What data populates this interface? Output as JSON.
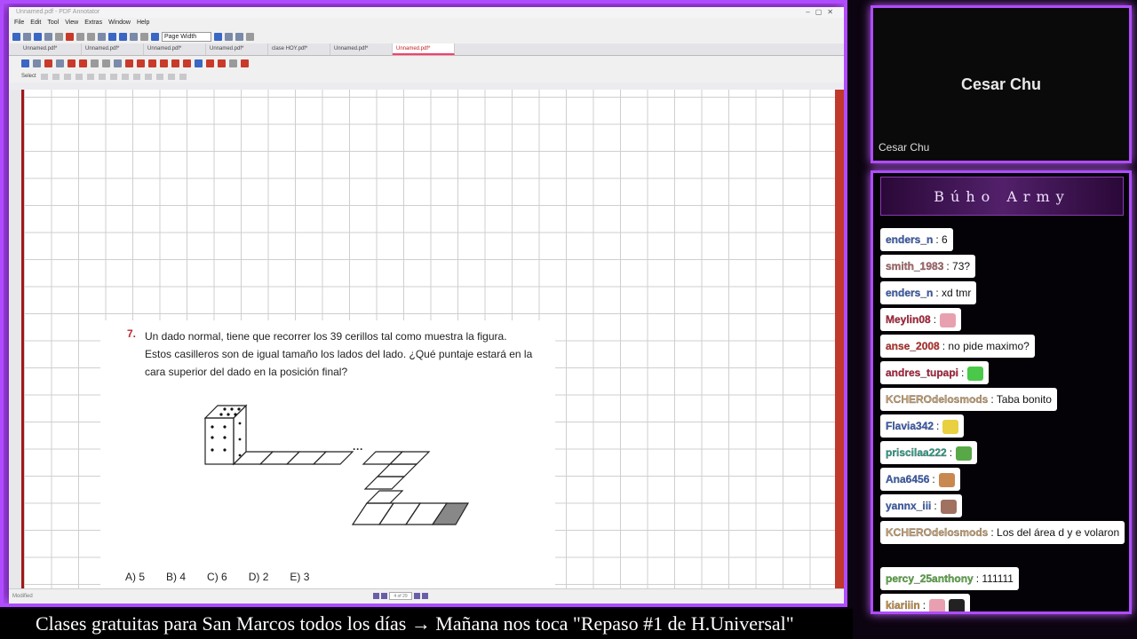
{
  "app": {
    "title": "Unnamed.pdf - PDF Annotator",
    "menu": [
      "File",
      "Edit",
      "Tool",
      "View",
      "Extras",
      "Window",
      "Help"
    ],
    "zoom_value": "Page Width",
    "tabs": [
      "Unnamed.pdf*",
      "Unnamed.pdf*",
      "Unnamed.pdf*",
      "Unnamed.pdf*",
      "clase HOY.pdf*",
      "Unnamed.pdf*",
      "Unnamed.pdf*"
    ],
    "active_tab": 6,
    "toolbar3_label": "Select",
    "status_left": "Modified",
    "page_indicator": "4 of 29"
  },
  "problem": {
    "number": "7.",
    "text": "Un dado normal, tiene que recorrer los 39 cerillos tal como muestra la figura. Estos casilleros son de igual tamaño los lados del lado. ¿Qué puntaje estará en la cara superior del dado en la posición final?",
    "dots": "···",
    "answers": [
      "A) 5",
      "B) 4",
      "C) 6",
      "D) 2",
      "E) 3"
    ]
  },
  "camera": {
    "name": "Cesar Chu",
    "label": "Cesar Chu"
  },
  "chat": {
    "title": "Búho Army",
    "messages": [
      {
        "user": "enders_n",
        "color": "#3a5fb8",
        "text": ": 6"
      },
      {
        "user": "smith_1983",
        "color": "#b06a6a",
        "text": ": 73?"
      },
      {
        "user": "enders_n",
        "color": "#3a5fb8",
        "text": ": xd tmr"
      },
      {
        "user": "Meylin08",
        "color": "#b8203a",
        "text": ":",
        "emote": "#e8a0b0"
      },
      {
        "user": "anse_2008",
        "color": "#c8302a",
        "text": ": no pide maximo?"
      },
      {
        "user": "andres_tupapi",
        "color": "#b8203a",
        "text": ":",
        "emote": "#4ac84a"
      },
      {
        "user": "KCHEROdelosmods",
        "color": "#c8a070",
        "text": ": Taba bonito"
      },
      {
        "user": "Flavia342",
        "color": "#3a5fb8",
        "text": ":",
        "emote": "#e8d040"
      },
      {
        "user": "priscilaa222",
        "color": "#2aa088",
        "text": ":",
        "emote": "#58a848"
      },
      {
        "user": "Ana6456",
        "color": "#3a5fb8",
        "text": ":",
        "emote": "#c88850"
      },
      {
        "user": "yannx_iii",
        "color": "#3a5fb8",
        "text": ":",
        "emote": "#a07060"
      },
      {
        "user": "KCHEROdelosmods",
        "color": "#c8a070",
        "text": ": Los del área d y e volaron"
      },
      {
        "user": "percy_25anthony",
        "color": "#58b040",
        "text": ": 111111"
      },
      {
        "user": "kiariiin",
        "color": "#c89040",
        "text": ":",
        "emote": "#e8a0b0",
        "emote2": "#222222"
      }
    ]
  },
  "ticker": "Clases gratuitas para San Marcos todos los días  →  Mañana nos toca \"Repaso #1 de H.Universal\""
}
